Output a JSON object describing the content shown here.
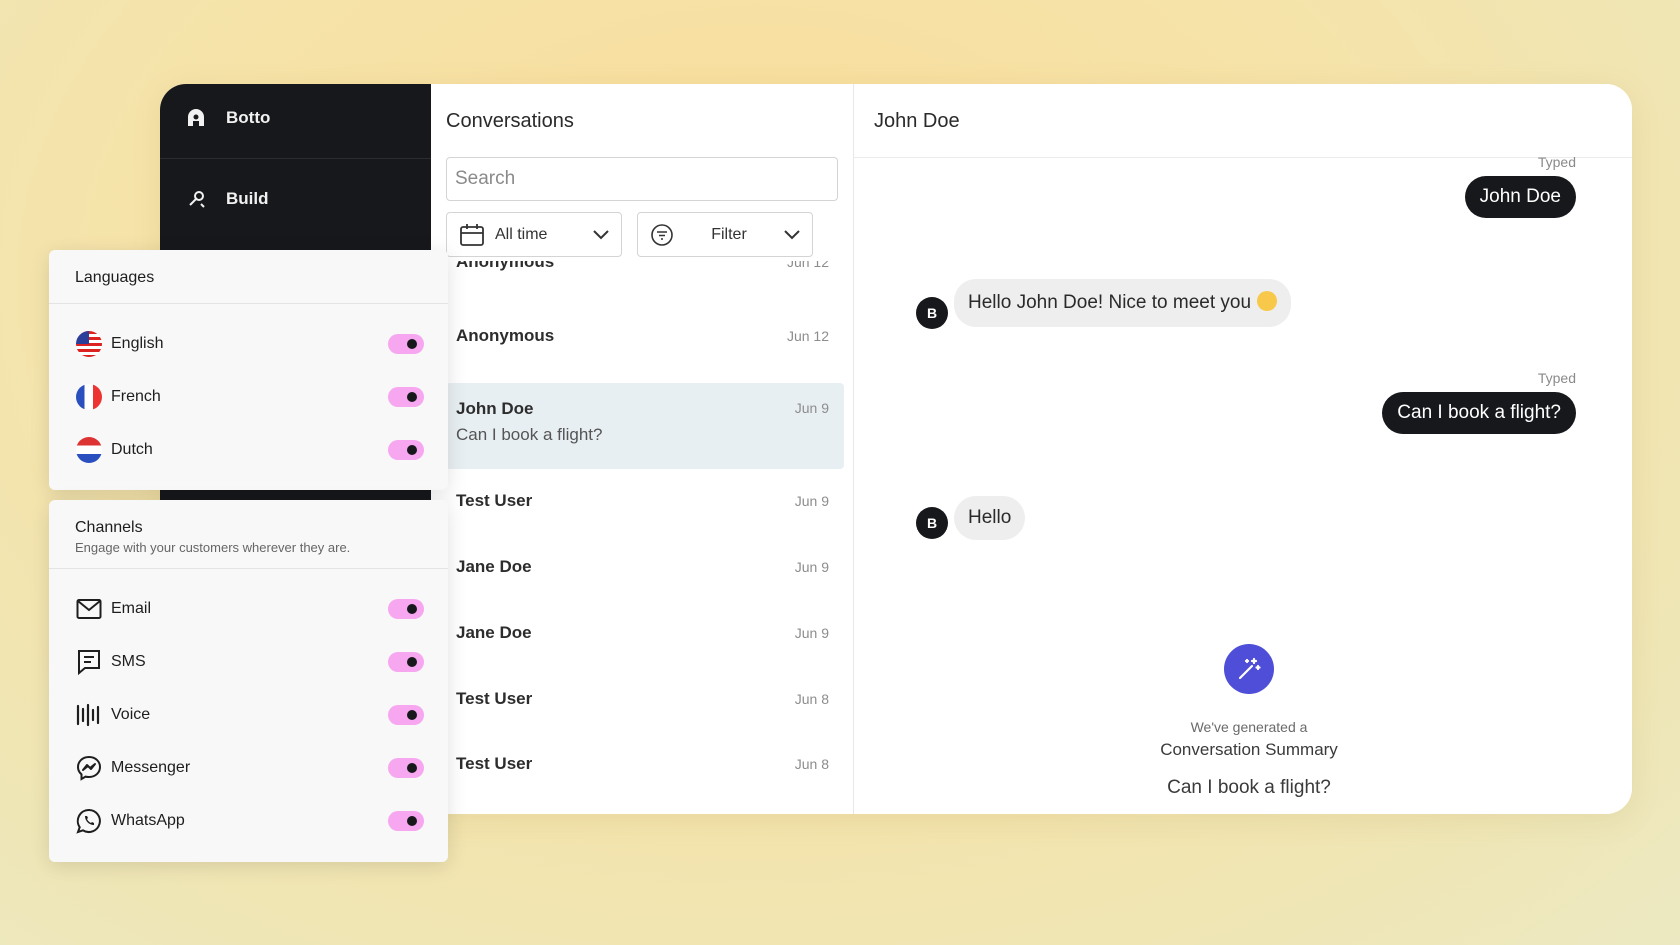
{
  "sidebar": {
    "brand": "Botto",
    "build": "Build"
  },
  "conversations": {
    "title": "Conversations",
    "search_placeholder": "Search",
    "time_filter": "All time",
    "filter_label": "Filter",
    "partial_row": {
      "name": "Anonymous",
      "date": "Jun 12"
    },
    "items": [
      {
        "name": "Anonymous",
        "date": "Jun 12",
        "preview": ""
      },
      {
        "name": "John Doe",
        "date": "Jun 9",
        "preview": "Can I book a flight?"
      },
      {
        "name": "Test User",
        "date": "Jun 9",
        "preview": ""
      },
      {
        "name": "Jane Doe",
        "date": "Jun 9",
        "preview": ""
      },
      {
        "name": "Jane Doe",
        "date": "Jun 9",
        "preview": ""
      },
      {
        "name": "Test User",
        "date": "Jun 8",
        "preview": ""
      },
      {
        "name": "Test User",
        "date": "Jun 8",
        "preview": ""
      }
    ]
  },
  "chat": {
    "title": "John Doe",
    "typed_label": "Typed",
    "messages": [
      {
        "from": "user",
        "text": "John Doe"
      },
      {
        "from": "bot",
        "avatar": "B",
        "text": "Hello John Doe! Nice to meet you"
      },
      {
        "from": "user",
        "text": "Can I book a flight?"
      },
      {
        "from": "bot",
        "avatar": "B",
        "text": "Hello"
      }
    ],
    "summary": {
      "line1": "We've generated a",
      "line2": "Conversation Summary",
      "line3": "Can I book a flight?"
    }
  },
  "languages": {
    "title": "Languages",
    "items": [
      {
        "label": "English",
        "icon": "us-flag-icon",
        "enabled": true
      },
      {
        "label": "French",
        "icon": "france-flag-icon",
        "enabled": true
      },
      {
        "label": "Dutch",
        "icon": "netherlands-flag-icon",
        "enabled": true
      }
    ]
  },
  "channels": {
    "title": "Channels",
    "subtitle": "Engage with your customers wherever they are.",
    "items": [
      {
        "label": "Email",
        "icon": "email-icon",
        "enabled": true
      },
      {
        "label": "SMS",
        "icon": "sms-icon",
        "enabled": true
      },
      {
        "label": "Voice",
        "icon": "voice-icon",
        "enabled": true
      },
      {
        "label": "Messenger",
        "icon": "messenger-icon",
        "enabled": true
      },
      {
        "label": "WhatsApp",
        "icon": "whatsapp-icon",
        "enabled": true
      }
    ]
  },
  "colors": {
    "sidebar": "#17181b",
    "toggle_on": "#f7a6f0",
    "summary_button": "#4e4ed8",
    "active_row": "#e8eff2"
  }
}
